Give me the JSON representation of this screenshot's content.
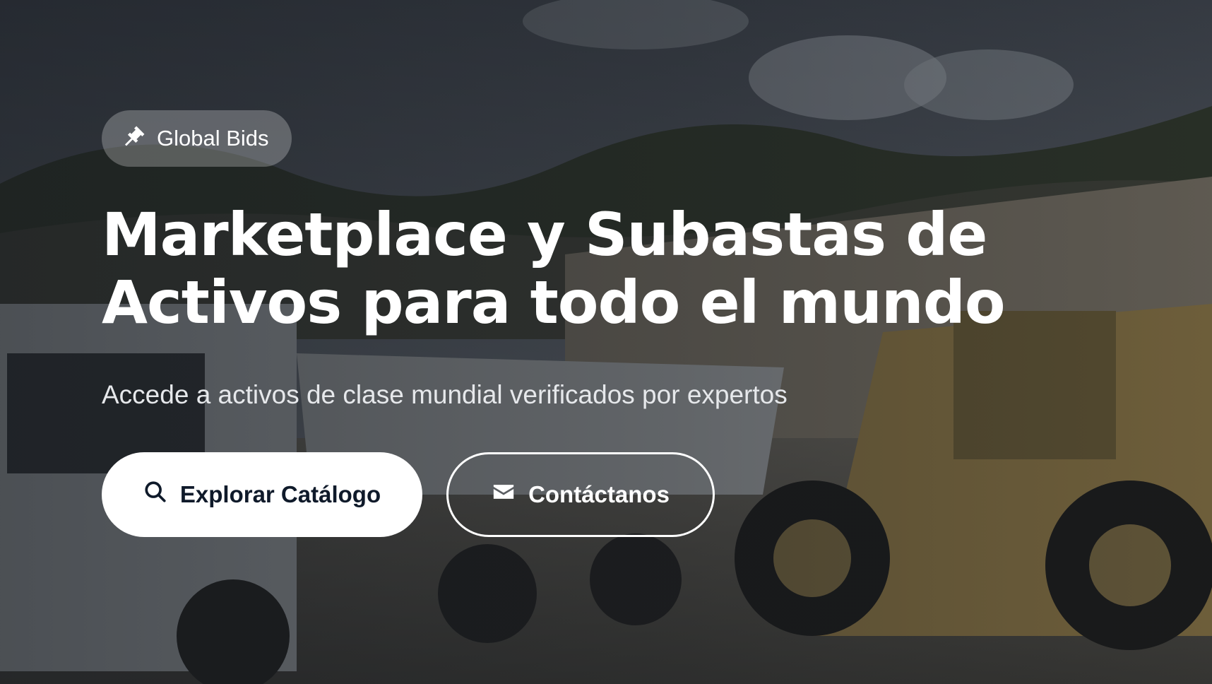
{
  "badge": {
    "icon": "gavel-icon",
    "label": "Global Bids"
  },
  "hero": {
    "title_line1": "Marketplace y Subastas de",
    "title_line2": "Activos para todo el mundo",
    "subtitle": "Accede a activos de clase mundial verificados por expertos"
  },
  "actions": {
    "primary": {
      "icon": "search-icon",
      "label": "Explorar Catálogo"
    },
    "secondary": {
      "icon": "envelope-icon",
      "label": "Contáctanos"
    }
  },
  "colors": {
    "primary_text": "#0f1a2a",
    "white": "#ffffff"
  }
}
